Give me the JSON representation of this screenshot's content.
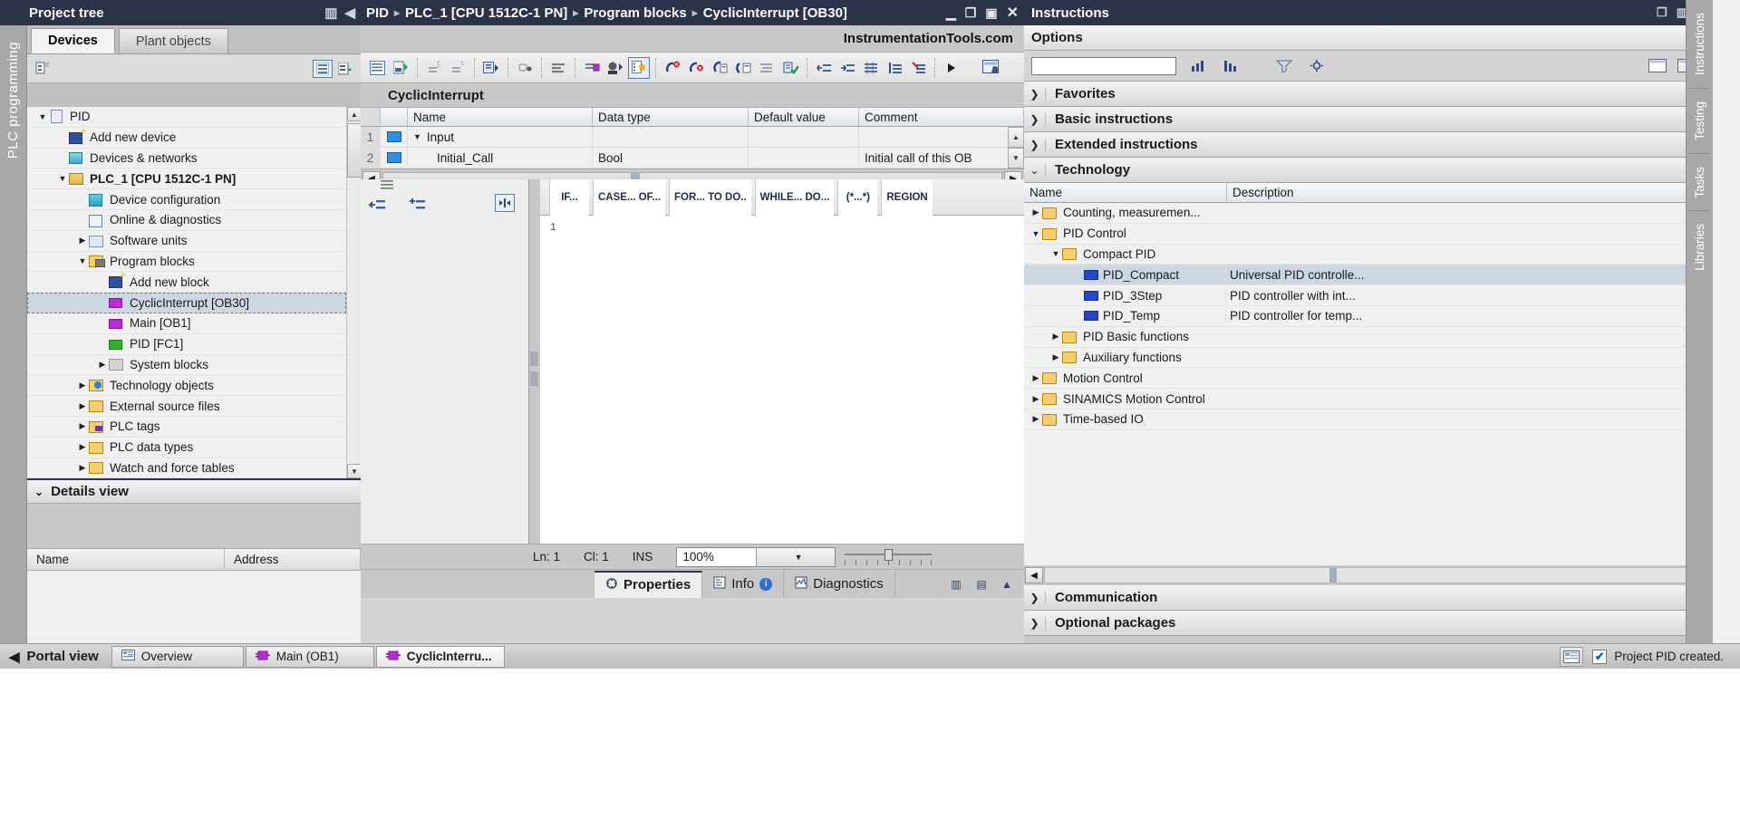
{
  "project_tree": {
    "title": "Project tree",
    "vertical_tab": "PLC programming",
    "tabs": [
      {
        "label": "Devices",
        "active": true
      },
      {
        "label": "Plant objects",
        "active": false
      }
    ],
    "toolbar": {
      "collapse_icon": "collapse-tree-icon",
      "list_icon": "list-view-icon",
      "tree_icon": "tree-view-icon"
    },
    "items": [
      {
        "label": "PID",
        "indent": 0,
        "arrow": "down",
        "icon": "project-icon",
        "bold": false,
        "selected": false
      },
      {
        "label": "Add new device",
        "indent": 1,
        "arrow": "",
        "icon": "add-new-device-icon",
        "bold": false,
        "selected": false
      },
      {
        "label": "Devices & networks",
        "indent": 1,
        "arrow": "",
        "icon": "devices-networks-icon",
        "bold": false,
        "selected": false
      },
      {
        "label": "PLC_1 [CPU 1512C-1 PN]",
        "indent": 1,
        "arrow": "down",
        "icon": "plc-icon",
        "bold": true,
        "selected": false
      },
      {
        "label": "Device configuration",
        "indent": 2,
        "arrow": "",
        "icon": "device-configuration-icon",
        "bold": false,
        "selected": false
      },
      {
        "label": "Online & diagnostics",
        "indent": 2,
        "arrow": "",
        "icon": "online-diagnostics-icon",
        "bold": false,
        "selected": false
      },
      {
        "label": "Software units",
        "indent": 2,
        "arrow": "right",
        "icon": "software-units-icon",
        "bold": false,
        "selected": false
      },
      {
        "label": "Program blocks",
        "indent": 2,
        "arrow": "down",
        "icon": "program-blocks-icon",
        "bold": false,
        "selected": false
      },
      {
        "label": "Add new block",
        "indent": 3,
        "arrow": "",
        "icon": "add-new-block-icon",
        "bold": false,
        "selected": false
      },
      {
        "label": "CyclicInterrupt [OB30]",
        "indent": 3,
        "arrow": "",
        "icon": "ob-block-icon",
        "bold": false,
        "selected": true
      },
      {
        "label": "Main [OB1]",
        "indent": 3,
        "arrow": "",
        "icon": "ob-block-icon",
        "bold": false,
        "selected": false
      },
      {
        "label": "PID [FC1]",
        "indent": 3,
        "arrow": "",
        "icon": "fc-block-icon",
        "bold": false,
        "selected": false
      },
      {
        "label": "System blocks",
        "indent": 3,
        "arrow": "right",
        "icon": "system-blocks-icon",
        "bold": false,
        "selected": false
      },
      {
        "label": "Technology objects",
        "indent": 2,
        "arrow": "right",
        "icon": "technology-objects-icon",
        "bold": false,
        "selected": false
      },
      {
        "label": "External source files",
        "indent": 2,
        "arrow": "right",
        "icon": "external-source-files-icon",
        "bold": false,
        "selected": false
      },
      {
        "label": "PLC tags",
        "indent": 2,
        "arrow": "right",
        "icon": "plc-tags-icon",
        "bold": false,
        "selected": false
      },
      {
        "label": "PLC data types",
        "indent": 2,
        "arrow": "right",
        "icon": "plc-data-types-icon",
        "bold": false,
        "selected": false
      },
      {
        "label": "Watch and force tables",
        "indent": 2,
        "arrow": "right",
        "icon": "watch-force-tables-icon",
        "bold": false,
        "selected": false
      }
    ],
    "details_view": {
      "title": "Details view",
      "columns": [
        "Name",
        "Address"
      ]
    }
  },
  "editor": {
    "breadcrumb": [
      "PID",
      "PLC_1 [CPU 1512C-1 PN]",
      "Program blocks",
      "CyclicInterrupt [OB30]"
    ],
    "window_buttons": [
      "minimize",
      "restore",
      "maximize",
      "close"
    ],
    "brand": "InstrumentationTools.com",
    "block_name": "CyclicInterrupt",
    "interface": {
      "columns": [
        "Name",
        "Data type",
        "Default value",
        "Comment"
      ],
      "rows": [
        {
          "num": "1",
          "name": "Input",
          "data_type": "",
          "default_value": "",
          "comment": "",
          "group": true
        },
        {
          "num": "2",
          "name": "Initial_Call",
          "data_type": "Bool",
          "default_value": "",
          "comment": "Initial call of this OB",
          "group": false
        }
      ]
    },
    "scl_keywords": [
      "IF...",
      "CASE... OF...",
      "FOR... TO DO..",
      "WHILE... DO...",
      "(*...*)",
      "REGION"
    ],
    "code_lines": [
      "1"
    ],
    "status": {
      "line_label": "Ln: 1",
      "col_label": "Cl: 1",
      "ins_label": "INS",
      "zoom": "100%"
    }
  },
  "bottom_tabs": [
    {
      "label": "Properties",
      "icon": "properties-icon",
      "active": true
    },
    {
      "label": "Info",
      "icon": "info-icon",
      "active": false,
      "badge": "i"
    },
    {
      "label": "Diagnostics",
      "icon": "diagnostics-icon",
      "active": false
    }
  ],
  "instructions": {
    "title": "Instructions",
    "options_label": "Options",
    "search_value": "",
    "sections_top": [
      {
        "label": "Favorites",
        "expanded": false
      },
      {
        "label": "Basic instructions",
        "expanded": false
      },
      {
        "label": "Extended instructions",
        "expanded": false
      },
      {
        "label": "Technology",
        "expanded": true
      }
    ],
    "columns": [
      "Name",
      "Description"
    ],
    "tree": [
      {
        "name": "Counting, measuremen...",
        "description": "",
        "indent": 0,
        "arrow": "right",
        "icon": "folder-icon",
        "selected": false
      },
      {
        "name": "PID Control",
        "description": "",
        "indent": 0,
        "arrow": "down",
        "icon": "folder-icon",
        "selected": false
      },
      {
        "name": "Compact PID",
        "description": "",
        "indent": 1,
        "arrow": "down",
        "icon": "folder-icon",
        "selected": false
      },
      {
        "name": "PID_Compact",
        "description": "Universal PID controlle...",
        "indent": 2,
        "arrow": "",
        "icon": "instruction-block-icon",
        "selected": true
      },
      {
        "name": "PID_3Step",
        "description": "PID controller with int...",
        "indent": 2,
        "arrow": "",
        "icon": "instruction-block-icon",
        "selected": false
      },
      {
        "name": "PID_Temp",
        "description": "PID controller for temp...",
        "indent": 2,
        "arrow": "",
        "icon": "instruction-block-icon",
        "selected": false
      },
      {
        "name": "PID Basic functions",
        "description": "",
        "indent": 1,
        "arrow": "right",
        "icon": "folder-icon",
        "selected": false
      },
      {
        "name": "Auxiliary functions",
        "description": "",
        "indent": 1,
        "arrow": "right",
        "icon": "folder-icon",
        "selected": false
      },
      {
        "name": "Motion Control",
        "description": "",
        "indent": 0,
        "arrow": "right",
        "icon": "folder-icon",
        "selected": false
      },
      {
        "name": "SINAMICS Motion Control",
        "description": "",
        "indent": 0,
        "arrow": "right",
        "icon": "folder-icon",
        "selected": false
      },
      {
        "name": "Time-based IO",
        "description": "",
        "indent": 0,
        "arrow": "right",
        "icon": "folder-icon",
        "selected": false
      }
    ],
    "sections_bottom": [
      {
        "label": "Communication",
        "expanded": false
      },
      {
        "label": "Optional packages",
        "expanded": false
      }
    ],
    "vertical_tabs": [
      "Instructions",
      "Testing",
      "Tasks",
      "Libraries"
    ]
  },
  "taskbar": {
    "portal_view": "Portal view",
    "items": [
      {
        "label": "Overview",
        "icon": "overview-icon",
        "active": false
      },
      {
        "label": "Main (OB1)",
        "icon": "ob-block-icon",
        "active": false
      },
      {
        "label": "CyclicInterru...",
        "icon": "ob-block-icon",
        "active": true
      }
    ],
    "status_message": "Project PID created.",
    "status_icon": "check-icon"
  },
  "colors": {
    "title_bar": "#2b3349",
    "selection": "#cdd7e2",
    "panel": "#c8c8c8",
    "accent_blue": "#2446c8"
  }
}
